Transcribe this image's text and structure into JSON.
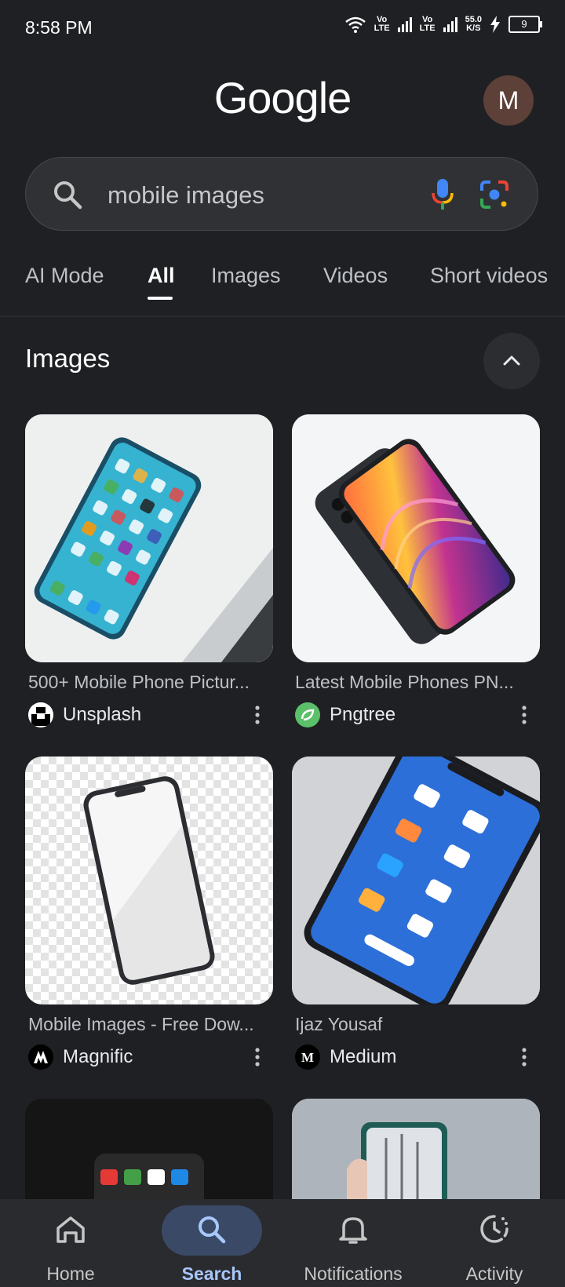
{
  "status_bar": {
    "time": "8:58 PM",
    "sim1": "Vo\nLTE",
    "sim2": "Vo\nLTE",
    "speed_value": "55.0",
    "speed_unit": "K/S",
    "battery": "9"
  },
  "header": {
    "logo": "Google",
    "avatar_initial": "M"
  },
  "search": {
    "query": "mobile images"
  },
  "tabs": [
    {
      "label": "AI Mode",
      "active": false
    },
    {
      "label": "All",
      "active": true
    },
    {
      "label": "Images",
      "active": false
    },
    {
      "label": "Videos",
      "active": false
    },
    {
      "label": "Short videos",
      "active": false
    }
  ],
  "images_section": {
    "title": "Images",
    "results": [
      {
        "caption": "500+ Mobile Phone Pictur...",
        "source": "Unsplash"
      },
      {
        "caption": "Latest Mobile Phones PN...",
        "source": "Pngtree"
      },
      {
        "caption": "Mobile Images - Free Dow...",
        "source": "Magnific"
      },
      {
        "caption": "Ijaz Yousaf",
        "source": "Medium"
      }
    ]
  },
  "bottom_nav": [
    {
      "label": "Home",
      "icon": "home-icon",
      "active": false
    },
    {
      "label": "Search",
      "icon": "search-icon",
      "active": true
    },
    {
      "label": "Notifications",
      "icon": "bell-icon",
      "active": false
    },
    {
      "label": "Activity",
      "icon": "activity-icon",
      "active": false
    }
  ],
  "colors": {
    "background": "#1f2024",
    "search_box": "#303134",
    "nav_active": "#a8c7fa",
    "avatar": "#5d4037"
  }
}
